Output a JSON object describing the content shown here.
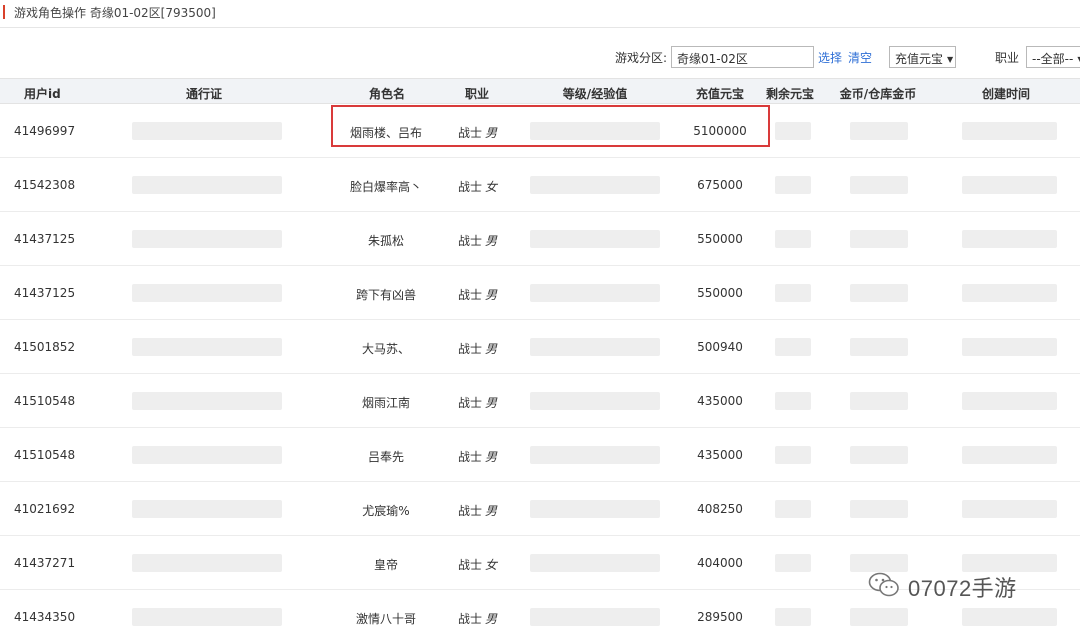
{
  "header": {
    "title": "游戏角色操作  奇缘01-02区[793500]"
  },
  "filter": {
    "zone_label": "游戏分区:",
    "zone_value": "奇缘01-02区",
    "select_link": "选择",
    "clear_link": "清空",
    "sort_select": "充值元宝",
    "job_label": "职业",
    "job_select": "--全部--"
  },
  "table": {
    "columns": [
      "用户id",
      "通行证",
      "角色名",
      "职业",
      "等级/经验值",
      "充值元宝",
      "剩余元宝",
      "金币/仓库金币",
      "创建时间"
    ],
    "rows": [
      {
        "user_id": "41496997",
        "role_name": "烟雨楼、吕布",
        "job": "战士",
        "gender": "男",
        "recharge": "5100000"
      },
      {
        "user_id": "41542308",
        "role_name": "脸白爆率高丶",
        "job": "战士",
        "gender": "女",
        "recharge": "675000"
      },
      {
        "user_id": "41437125",
        "role_name": "朱孤松",
        "job": "战士",
        "gender": "男",
        "recharge": "550000"
      },
      {
        "user_id": "41437125",
        "role_name": "跨下有凶兽",
        "job": "战士",
        "gender": "男",
        "recharge": "550000"
      },
      {
        "user_id": "41501852",
        "role_name": "大马苏、",
        "job": "战士",
        "gender": "男",
        "recharge": "500940"
      },
      {
        "user_id": "41510548",
        "role_name": "烟雨江南",
        "job": "战士",
        "gender": "男",
        "recharge": "435000"
      },
      {
        "user_id": "41510548",
        "role_name": "吕奉先",
        "job": "战士",
        "gender": "男",
        "recharge": "435000"
      },
      {
        "user_id": "41021692",
        "role_name": "尤宸瑜%",
        "job": "战士",
        "gender": "男",
        "recharge": "408250"
      },
      {
        "user_id": "41437271",
        "role_name": "皇帝",
        "job": "战士",
        "gender": "女",
        "recharge": "404000"
      },
      {
        "user_id": "41434350",
        "role_name": "激情八十哥",
        "job": "战士",
        "gender": "男",
        "recharge": "289500"
      }
    ]
  },
  "watermark": {
    "text": "07072手游"
  },
  "colors": {
    "highlight": "#d93a3a",
    "link": "#2f6fd6",
    "header_bg": "#f1f3f6",
    "accent": "#d9412b"
  }
}
